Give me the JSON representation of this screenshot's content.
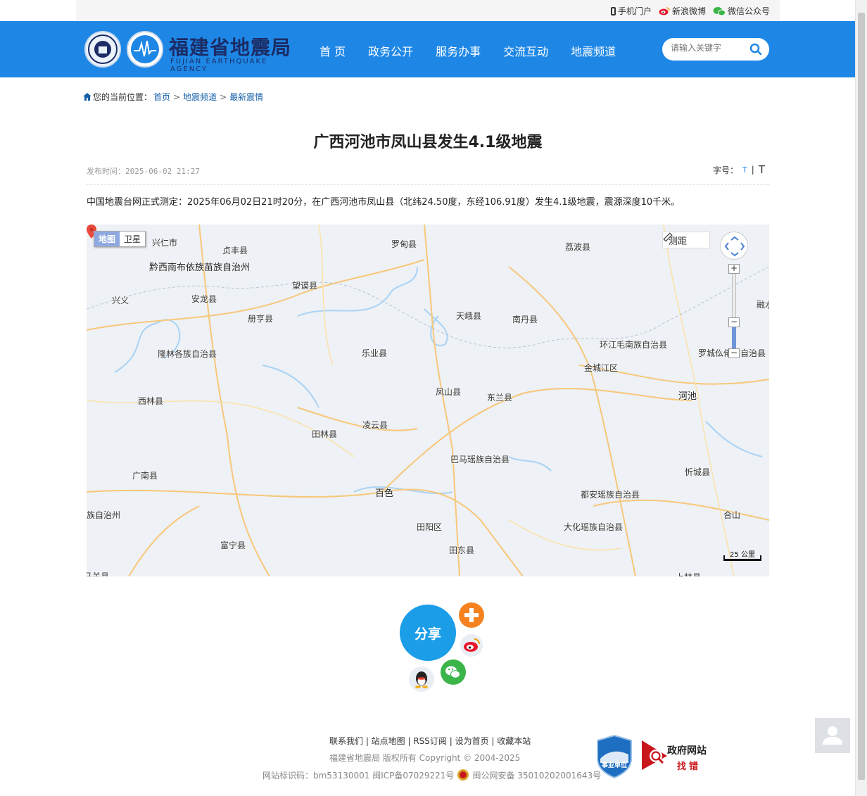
{
  "topbar": {
    "mobile": "手机门户",
    "weibo": "新浪微博",
    "wechat": "微信公众号"
  },
  "header": {
    "logo_title": "福建省地震局",
    "logo_subtitle": "FUJIAN EARTHQUAKE AGENCY",
    "nav": [
      "首 页",
      "政务公开",
      "服务办事",
      "交流互动",
      "地震频道"
    ],
    "search_placeholder": "请输入关键字"
  },
  "breadcrumb": {
    "prefix": "您的当前位置：",
    "items": [
      "首页",
      "地震频道",
      "最新震情"
    ]
  },
  "article": {
    "title": "广西河池市凤山县发生4.1级地震",
    "publish_time": "发布时间：2025-06-02 21:27",
    "font_size_label": "字号：",
    "font_small": "T",
    "font_sep": "|",
    "font_large": "T",
    "body": "中国地震台网正式测定：2025年06月02日21时20分，在广西河池市凤山县（北纬24.50度，东经106.91度）发生4.1级地震，震源深度10千米。"
  },
  "map": {
    "type_map": "地图",
    "type_satellite": "卫星",
    "measure": "测距",
    "scale": "25 公里",
    "places": [
      "兴仁市",
      "贞丰县",
      "罗甸县",
      "荔波县",
      "黔西南布依族苗族自治州",
      "望谟县",
      "兴义",
      "安龙县",
      "册亨县",
      "天峨县",
      "南丹县",
      "融水",
      "环江毛南族自治县",
      "隆林各族自治县",
      "乐业县",
      "罗城仫佬族自治县",
      "金城江区",
      "凤山县",
      "东兰县",
      "河池",
      "西林县",
      "凌云县",
      "田林县",
      "巴马瑶族自治县",
      "忻城县",
      "广南县",
      "百色",
      "都安瑶族自治县",
      "族自治州",
      "田阳区",
      "大化瑶族自治县",
      "合山",
      "富宁县",
      "田东县",
      "上林县",
      "马关县"
    ]
  },
  "share": {
    "label": "分享"
  },
  "footer": {
    "links": "联系我们 | 站点地图 | RSS订阅 | 设为首页 | 收藏本站",
    "copyright": "福建省地震局   版权所有    Copyright © 2004-2025",
    "site_id": "网站标识码：bm53130001   闽ICP备07029221号",
    "police": "闽公网安备 35010202001643号",
    "badge_unit": "事业单位",
    "gov_line1": "政府网站",
    "gov_line2": "找错"
  }
}
